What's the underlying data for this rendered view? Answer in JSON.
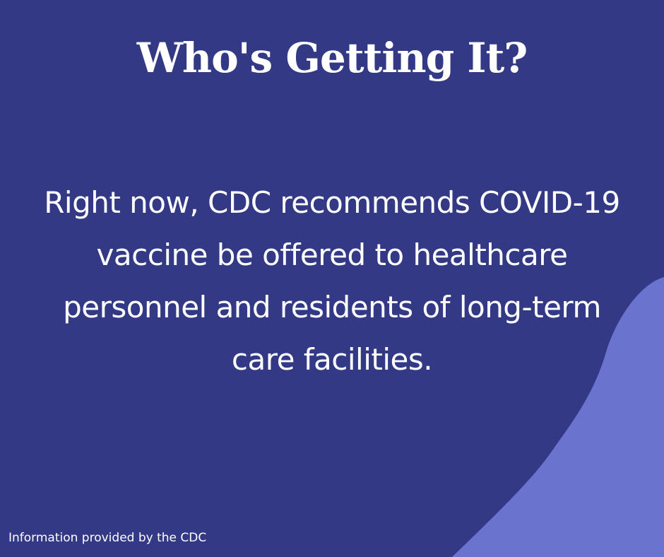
{
  "colors": {
    "background": "#333985",
    "accent_blob": "#6a74cf",
    "text": "#ffffff"
  },
  "header": {
    "title": "Who's Getting It?"
  },
  "main": {
    "message": "Right now, CDC recommends COVID-19 vaccine be offered to healthcare personnel and residents of long-term care facilities."
  },
  "footer": {
    "credit": "Information provided by the CDC"
  }
}
